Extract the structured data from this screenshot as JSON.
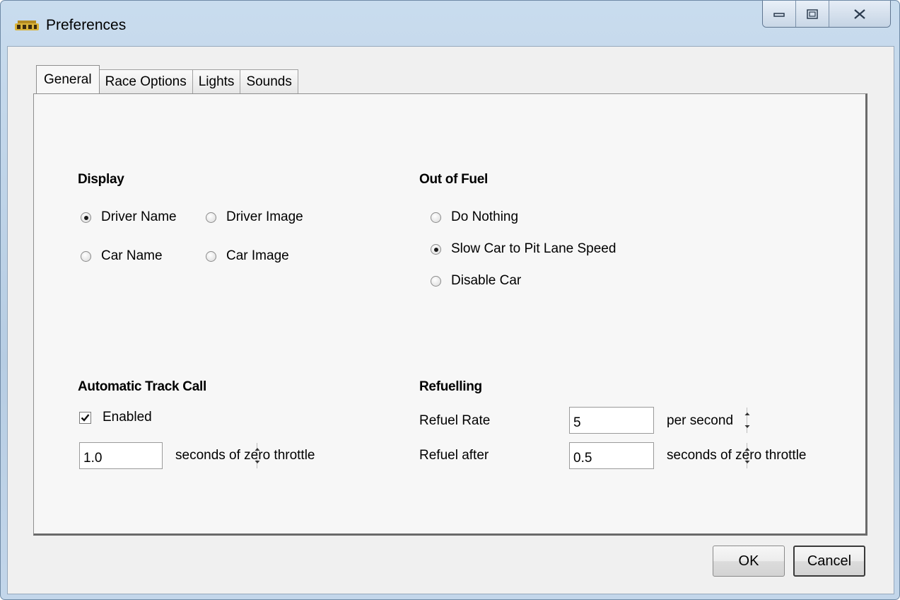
{
  "window": {
    "title": "Preferences",
    "app_icon": "app-logo-icon",
    "controls": {
      "minimize": "minimize-icon",
      "maximize": "maximize-icon",
      "close": "close-icon"
    }
  },
  "tabs": [
    {
      "label": "General",
      "selected": true
    },
    {
      "label": "Race Options",
      "selected": false
    },
    {
      "label": "Lights",
      "selected": false
    },
    {
      "label": "Sounds",
      "selected": false
    }
  ],
  "display": {
    "heading": "Display",
    "options": [
      {
        "label": "Driver Name",
        "checked": true
      },
      {
        "label": "Driver Image",
        "checked": false
      },
      {
        "label": "Car Name",
        "checked": false
      },
      {
        "label": "Car Image",
        "checked": false
      }
    ]
  },
  "out_of_fuel": {
    "heading": "Out of Fuel",
    "options": [
      {
        "label": "Do Nothing",
        "checked": false
      },
      {
        "label": "Slow Car to Pit Lane Speed",
        "checked": true
      },
      {
        "label": "Disable Car",
        "checked": false
      }
    ]
  },
  "track_call": {
    "heading": "Automatic Track Call",
    "enabled_label": "Enabled",
    "enabled": true,
    "seconds_value": "1.0",
    "seconds_label": "seconds of zero throttle"
  },
  "refuelling": {
    "heading": "Refuelling",
    "rate_label": "Refuel Rate",
    "rate_value": "5",
    "rate_unit": "per second",
    "after_label": "Refuel after",
    "after_value": "0.5",
    "after_unit": "seconds of zero throttle"
  },
  "buttons": {
    "ok": "OK",
    "cancel": "Cancel"
  }
}
